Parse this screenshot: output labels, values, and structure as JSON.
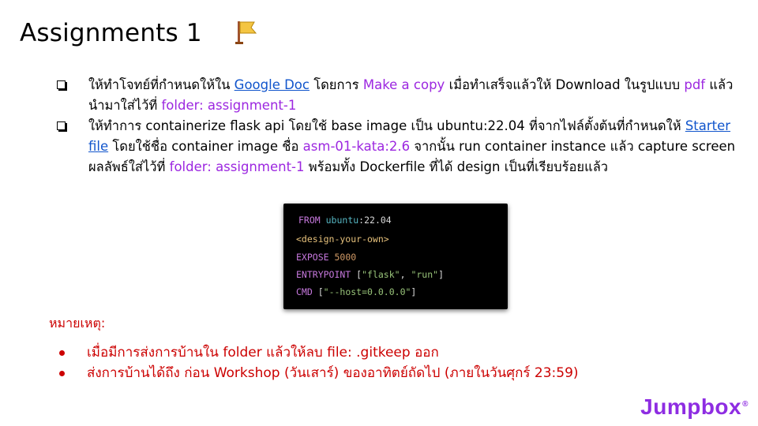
{
  "slide": {
    "title": "Assignments 1",
    "icon": "flag-icon"
  },
  "tasks": [
    {
      "segments": [
        {
          "text": "ให้ทำโจทย์ที่กำหนดให้ใน ",
          "style": "plain"
        },
        {
          "text": "Google Doc",
          "style": "link"
        },
        {
          "text": " โดยการ ",
          "style": "plain"
        },
        {
          "text": "Make a copy",
          "style": "purple"
        },
        {
          "text": " เมื่อทำเสร็จแล้วให้ Download ในรูปแบบ ",
          "style": "plain"
        },
        {
          "text": "pdf",
          "style": "purple"
        },
        {
          "text": " แล้วนำมาใส่ไว้ที่ ",
          "style": "plain"
        },
        {
          "text": "folder: assignment-1",
          "style": "purple"
        }
      ]
    },
    {
      "segments": [
        {
          "text": "ให้ทำการ containerize flask api โดยใช้ base image เป็น ubuntu:22.04 ที่จากไฟล์ตั้งต้นที่กำหนดให้ ",
          "style": "plain"
        },
        {
          "text": "Starter file",
          "style": "link"
        },
        {
          "text": " โดยใช้ชื่อ container image ชื่อ ",
          "style": "plain"
        },
        {
          "text": "asm-01-kata:2.6",
          "style": "purple"
        },
        {
          "text": " จากนั้น run container instance แล้ว capture screen ผลลัพธ์ใส่ไว้ที่ ",
          "style": "plain"
        },
        {
          "text": "folder: assignment-1",
          "style": "purple"
        },
        {
          "text": " พร้อมทั้ง Dockerfile ที่ได้ design เป็นที่เรียบร้อยแล้ว",
          "style": "plain"
        }
      ]
    }
  ],
  "code": {
    "lines": [
      [
        {
          "text": "FROM ",
          "style": "kw"
        },
        {
          "text": "ubuntu",
          "style": "img"
        },
        {
          "text": ":22.04",
          "style": "plain"
        }
      ],
      [
        {
          "text": "<design-your-own>",
          "style": "tag"
        }
      ],
      [
        {
          "text": "EXPOSE ",
          "style": "kw"
        },
        {
          "text": "5000",
          "style": "num"
        }
      ],
      [
        {
          "text": "ENTRYPOINT ",
          "style": "kw"
        },
        {
          "text": "[",
          "style": "plain"
        },
        {
          "text": "\"flask\"",
          "style": "str"
        },
        {
          "text": ", ",
          "style": "plain"
        },
        {
          "text": "\"run\"",
          "style": "str"
        },
        {
          "text": "]",
          "style": "plain"
        }
      ],
      [
        {
          "text": "CMD ",
          "style": "kw"
        },
        {
          "text": "[",
          "style": "plain"
        },
        {
          "text": "\"--host=0.0.0.0\"",
          "style": "str"
        },
        {
          "text": "]",
          "style": "plain"
        }
      ]
    ]
  },
  "notes": {
    "title": "หมายเหตุ:",
    "items": [
      "เมื่อมีการส่งการบ้านใน folder แล้วให้ลบ file: .gitkeep ออก",
      "ส่งการบ้านได้ถึง ก่อน Workshop (วันเสาร์) ของอาทิตย์ถัดไป (ภายในวันศุกร์ 23:59)"
    ]
  },
  "brand": {
    "name": "Jumpbox",
    "mark": "®",
    "color": "#8e2de2"
  }
}
